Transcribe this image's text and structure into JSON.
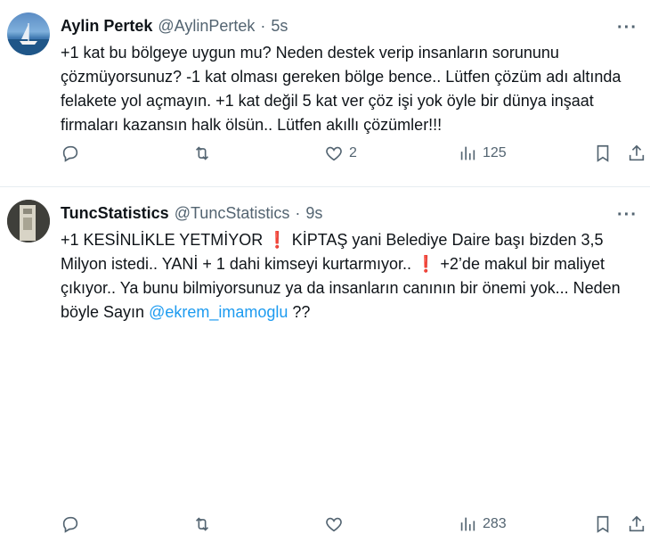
{
  "tweets": [
    {
      "name": "Aylin Pertek",
      "handle": "@AylinPertek",
      "separator": "·",
      "time": "5s",
      "text": "+1 kat bu bölgeye uygun mu? Neden destek verip insanların sorununu çözmüyorsunuz? -1 kat olması gereken bölge bence.. Lütfen çözüm adı altında felakete yol açmayın. +1 kat değil 5 kat ver çöz işi yok öyle bir dünya inşaat firmaları kazansın halk ölsün.. Lütfen akıllı çözümler!!!",
      "replies": "",
      "retweets": "",
      "likes": "2",
      "views": "125"
    },
    {
      "name": "TuncStatistics",
      "handle": "@TuncStatistics",
      "separator": "·",
      "time": "9s",
      "text_parts": {
        "p1": "+1 KESİNLİKLE YETMİYOR ",
        "bang1": "❗",
        "p2": " KİPTAŞ yani Belediye Daire başı bizden 3,5 Milyon istedi.. YANİ + 1 dahi kimseyi kurtarmıyor.. ",
        "bang2": "❗",
        "p3": " +2’de makul bir maliyet çıkıyor.. Ya bunu bilmiyorsunuz ya da insanların canının bir önemi yok... Neden böyle Sayın ",
        "mention": "@ekrem_imamoglu",
        "p4": " ??"
      },
      "replies": "",
      "retweets": "",
      "likes": "",
      "views": "283"
    }
  ],
  "icons": {
    "more": "more-icon",
    "reply": "reply-icon",
    "retweet": "retweet-icon",
    "like": "heart-icon",
    "views": "views-icon",
    "bookmark": "bookmark-icon",
    "share": "share-icon"
  },
  "more_glyph": "···",
  "colors": {
    "link": "#1d9bf0",
    "muted": "#536471",
    "text": "#0f1419",
    "divider": "#e6ecf0"
  }
}
